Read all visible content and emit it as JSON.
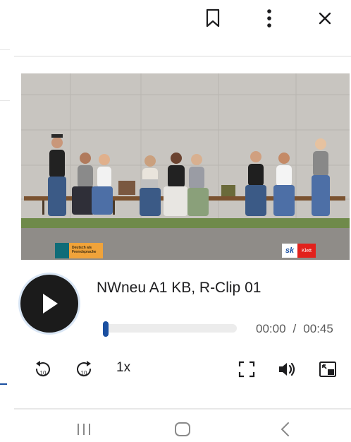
{
  "topbar": {
    "icons": [
      "bookmark-icon",
      "more-vertical-icon",
      "close-icon"
    ]
  },
  "video": {
    "badge_left_text": "Deutsch als Fremdsprache",
    "badge_right_text": "Klett"
  },
  "player": {
    "title": "NWneu A1 KB, R-Clip 01",
    "progress_fraction": 0.0,
    "current_time": "00:00",
    "time_separator": "/",
    "duration": "00:45",
    "speed_label": "1x",
    "rewind_label": "10",
    "forward_label": "10"
  },
  "colors": {
    "accent": "#1a4fa0",
    "play_button": "#1b1b1b",
    "track": "#ececec"
  },
  "system_nav": {
    "icons": [
      "recent-apps-icon",
      "home-icon",
      "back-icon"
    ]
  }
}
